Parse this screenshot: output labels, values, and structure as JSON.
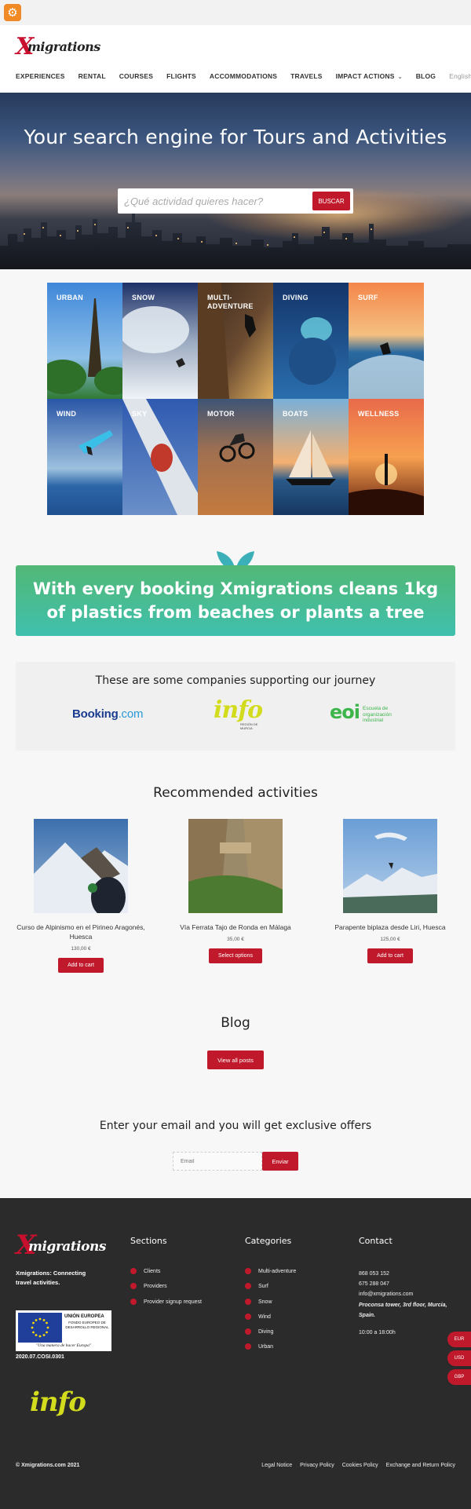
{
  "header": {
    "nav": [
      {
        "label": "EXPERIENCES"
      },
      {
        "label": "RENTAL"
      },
      {
        "label": "COURSES"
      },
      {
        "label": "FLIGHTS"
      },
      {
        "label": "ACCOMMODATIONS"
      },
      {
        "label": "TRAVELS"
      },
      {
        "label": "IMPACT ACTIONS",
        "dropdown": true
      },
      {
        "label": "BLOG"
      }
    ],
    "language": "English"
  },
  "hero": {
    "title": "Your search engine for Tours and Activities",
    "search_placeholder": "¿Qué actividad quieres hacer?",
    "search_button": "BUSCAR"
  },
  "categories": [
    {
      "label": "URBAN",
      "bg": [
        "#4a90d9",
        "#2a7a3a"
      ]
    },
    {
      "label": "SNOW",
      "bg": [
        "#243a6e",
        "#e8eef4"
      ]
    },
    {
      "label": "MULTI-ADVENTURE",
      "bg": [
        "#5a3e2a",
        "#d0a050"
      ]
    },
    {
      "label": "DIVING",
      "bg": [
        "#1a3e78",
        "#2a70b0"
      ]
    },
    {
      "label": "SURF",
      "bg": [
        "#f08040",
        "#2a6aa0"
      ]
    },
    {
      "label": "WIND",
      "bg": [
        "#2a5aa8",
        "#90b8d8"
      ]
    },
    {
      "label": "SKY",
      "bg": [
        "#3a6ab8",
        "#d8e0e8"
      ]
    },
    {
      "label": "MOTOR",
      "bg": [
        "#4a6080",
        "#c07a40"
      ]
    },
    {
      "label": "BOATS",
      "bg": [
        "#f0a060",
        "#1a3a6a"
      ]
    },
    {
      "label": "WELLNESS",
      "bg": [
        "#f07840",
        "#7a2010"
      ]
    }
  ],
  "impact_banner": "With every booking Xmigrations cleans 1kg of plastics from beaches or plants a tree",
  "partners": {
    "title": "These are some companies supporting our journey",
    "booking": [
      "Booking",
      ".com"
    ],
    "info": "info",
    "info_sub": "REGIÓN DE MURCIA",
    "eoi": "eoi",
    "eoi_sub": "Escuela de organización industrial"
  },
  "recommended": {
    "title": "Recommended activities",
    "products": [
      {
        "name": "Curso de Alpinismo en el Pirineo Aragonés, Huesca",
        "price": "130,00 €",
        "button": "Add to cart"
      },
      {
        "name": "Vía Ferrata Tajo de Ronda en Málaga",
        "price": "35,00 €",
        "button": "Select options"
      },
      {
        "name": "Parapente biplaza desde Liri, Huesca",
        "price": "125,00 €",
        "button": "Add to cart"
      }
    ]
  },
  "blog": {
    "title": "Blog",
    "button": "View all posts"
  },
  "newsletter": {
    "title": "Enter your email and you will get exclusive offers",
    "placeholder": "Email",
    "button": "Enviar"
  },
  "footer": {
    "tagline": "Xmigrations: Connecting travel activities.",
    "eu": {
      "title": "UNIÓN EUROPEA",
      "fund": "FONDO EUROPEO DE DESARROLLO REGIONAL",
      "motto": "\"Una manera de hacer Europa\""
    },
    "eu_code": "2020.07.COSI.0301",
    "info": "info",
    "sections_title": "Sections",
    "sections": [
      "Clients",
      "Providers",
      "Provider signup request"
    ],
    "categories_title": "Categories",
    "categories": [
      "Multi-adventure",
      "Surf",
      "Snow",
      "Wind",
      "Diving",
      "Urban"
    ],
    "contact_title": "Contact",
    "contact": {
      "phone1": "868 053 152",
      "phone2": "675 288 047",
      "email": "info@xmigrations.com",
      "address": "Proconsa tower, 3rd floor, Murcia, Spain.",
      "hours": "10:00 a 18:00h"
    },
    "copyright": "© Xmigrations.com 2021",
    "links": [
      "Legal Notice",
      "Privacy Policy",
      "Cookies Policy",
      "Exchange and Return Policy"
    ]
  },
  "currencies": [
    "EUR",
    "USD",
    "GBP"
  ],
  "brand": {
    "name": "Xmigrations",
    "accent": "#c0192b",
    "orange": "#f08a24"
  }
}
